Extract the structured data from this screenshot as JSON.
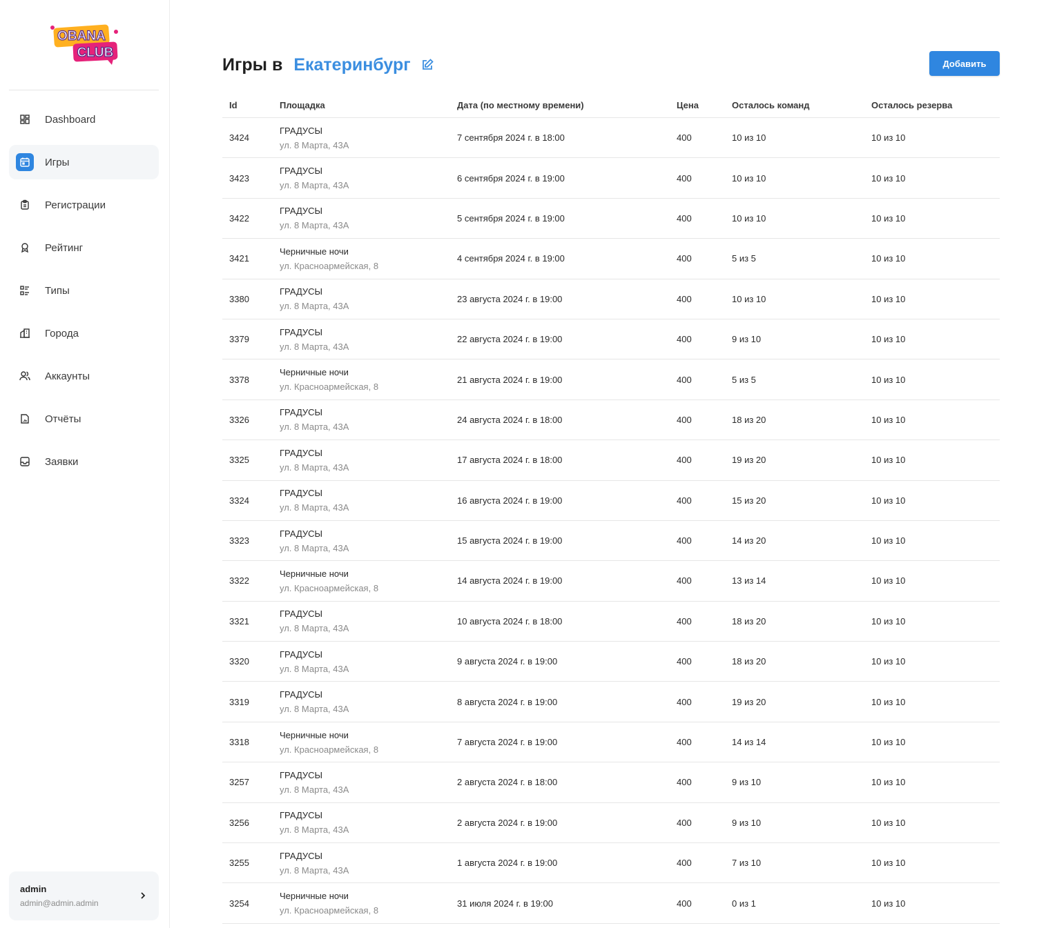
{
  "logo": {
    "line1": "OBANA",
    "line2": "CLUB"
  },
  "sidebar": {
    "items": [
      {
        "label": "Dashboard",
        "icon": "dashboard-icon",
        "active": false
      },
      {
        "label": "Игры",
        "icon": "calendar-icon",
        "active": true
      },
      {
        "label": "Регистрации",
        "icon": "clipboard-icon",
        "active": false
      },
      {
        "label": "Рейтинг",
        "icon": "award-icon",
        "active": false
      },
      {
        "label": "Типы",
        "icon": "list-icon",
        "active": false
      },
      {
        "label": "Города",
        "icon": "building-icon",
        "active": false
      },
      {
        "label": "Аккаунты",
        "icon": "users-icon",
        "active": false
      },
      {
        "label": "Отчёты",
        "icon": "report-icon",
        "active": false
      },
      {
        "label": "Заявки",
        "icon": "inbox-icon",
        "active": false
      }
    ]
  },
  "user": {
    "name": "admin",
    "email": "admin@admin.admin"
  },
  "header": {
    "title": "Игры в",
    "city": "Екатеринбург",
    "add_label": "Добавить"
  },
  "colors": {
    "accent": "#2f86e0",
    "city": "#3b8ee0"
  },
  "table": {
    "columns": [
      "Id",
      "Площадка",
      "Дата (по местному времени)",
      "Цена",
      "Осталось команд",
      "Осталось резерва"
    ],
    "rows": [
      {
        "id": "3424",
        "venue": "ГРАДУСЫ",
        "address": "ул. 8 Марта, 43А",
        "date": "7 сентября 2024 г. в 18:00",
        "price": "400",
        "teams": "10 из 10",
        "reserve": "10 из 10"
      },
      {
        "id": "3423",
        "venue": "ГРАДУСЫ",
        "address": "ул. 8 Марта, 43А",
        "date": "6 сентября 2024 г. в 19:00",
        "price": "400",
        "teams": "10 из 10",
        "reserve": "10 из 10"
      },
      {
        "id": "3422",
        "venue": "ГРАДУСЫ",
        "address": "ул. 8 Марта, 43А",
        "date": "5 сентября 2024 г. в 19:00",
        "price": "400",
        "teams": "10 из 10",
        "reserve": "10 из 10"
      },
      {
        "id": "3421",
        "venue": "Черничные ночи",
        "address": "ул. Красноармейская, 8",
        "date": "4 сентября 2024 г. в 19:00",
        "price": "400",
        "teams": "5 из 5",
        "reserve": "10 из 10"
      },
      {
        "id": "3380",
        "venue": "ГРАДУСЫ",
        "address": "ул. 8 Марта, 43А",
        "date": "23 августа 2024 г. в 19:00",
        "price": "400",
        "teams": "10 из 10",
        "reserve": "10 из 10"
      },
      {
        "id": "3379",
        "venue": "ГРАДУСЫ",
        "address": "ул. 8 Марта, 43А",
        "date": "22 августа 2024 г. в 19:00",
        "price": "400",
        "teams": "9 из 10",
        "reserve": "10 из 10"
      },
      {
        "id": "3378",
        "venue": "Черничные ночи",
        "address": "ул. Красноармейская, 8",
        "date": "21 августа 2024 г. в 19:00",
        "price": "400",
        "teams": "5 из 5",
        "reserve": "10 из 10"
      },
      {
        "id": "3326",
        "venue": "ГРАДУСЫ",
        "address": "ул. 8 Марта, 43А",
        "date": "24 августа 2024 г. в 18:00",
        "price": "400",
        "teams": "18 из 20",
        "reserve": "10 из 10"
      },
      {
        "id": "3325",
        "venue": "ГРАДУСЫ",
        "address": "ул. 8 Марта, 43А",
        "date": "17 августа 2024 г. в 18:00",
        "price": "400",
        "teams": "19 из 20",
        "reserve": "10 из 10"
      },
      {
        "id": "3324",
        "venue": "ГРАДУСЫ",
        "address": "ул. 8 Марта, 43А",
        "date": "16 августа 2024 г. в 19:00",
        "price": "400",
        "teams": "15 из 20",
        "reserve": "10 из 10"
      },
      {
        "id": "3323",
        "venue": "ГРАДУСЫ",
        "address": "ул. 8 Марта, 43А",
        "date": "15 августа 2024 г. в 19:00",
        "price": "400",
        "teams": "14 из 20",
        "reserve": "10 из 10"
      },
      {
        "id": "3322",
        "venue": "Черничные ночи",
        "address": "ул. Красноармейская, 8",
        "date": "14 августа 2024 г. в 19:00",
        "price": "400",
        "teams": "13 из 14",
        "reserve": "10 из 10"
      },
      {
        "id": "3321",
        "venue": "ГРАДУСЫ",
        "address": "ул. 8 Марта, 43А",
        "date": "10 августа 2024 г. в 18:00",
        "price": "400",
        "teams": "18 из 20",
        "reserve": "10 из 10"
      },
      {
        "id": "3320",
        "venue": "ГРАДУСЫ",
        "address": "ул. 8 Марта, 43А",
        "date": "9 августа 2024 г. в 19:00",
        "price": "400",
        "teams": "18 из 20",
        "reserve": "10 из 10"
      },
      {
        "id": "3319",
        "venue": "ГРАДУСЫ",
        "address": "ул. 8 Марта, 43А",
        "date": "8 августа 2024 г. в 19:00",
        "price": "400",
        "teams": "19 из 20",
        "reserve": "10 из 10"
      },
      {
        "id": "3318",
        "venue": "Черничные ночи",
        "address": "ул. Красноармейская, 8",
        "date": "7 августа 2024 г. в 19:00",
        "price": "400",
        "teams": "14 из 14",
        "reserve": "10 из 10"
      },
      {
        "id": "3257",
        "venue": "ГРАДУСЫ",
        "address": "ул. 8 Марта, 43А",
        "date": "2 августа 2024 г. в 18:00",
        "price": "400",
        "teams": "9 из 10",
        "reserve": "10 из 10"
      },
      {
        "id": "3256",
        "venue": "ГРАДУСЫ",
        "address": "ул. 8 Марта, 43А",
        "date": "2 августа 2024 г. в 19:00",
        "price": "400",
        "teams": "9 из 10",
        "reserve": "10 из 10"
      },
      {
        "id": "3255",
        "venue": "ГРАДУСЫ",
        "address": "ул. 8 Марта, 43А",
        "date": "1 августа 2024 г. в 19:00",
        "price": "400",
        "teams": "7 из 10",
        "reserve": "10 из 10"
      },
      {
        "id": "3254",
        "venue": "Черничные ночи",
        "address": "ул. Красноармейская, 8",
        "date": "31 июля 2024 г. в 19:00",
        "price": "400",
        "teams": "0 из 1",
        "reserve": "10 из 10"
      }
    ]
  }
}
